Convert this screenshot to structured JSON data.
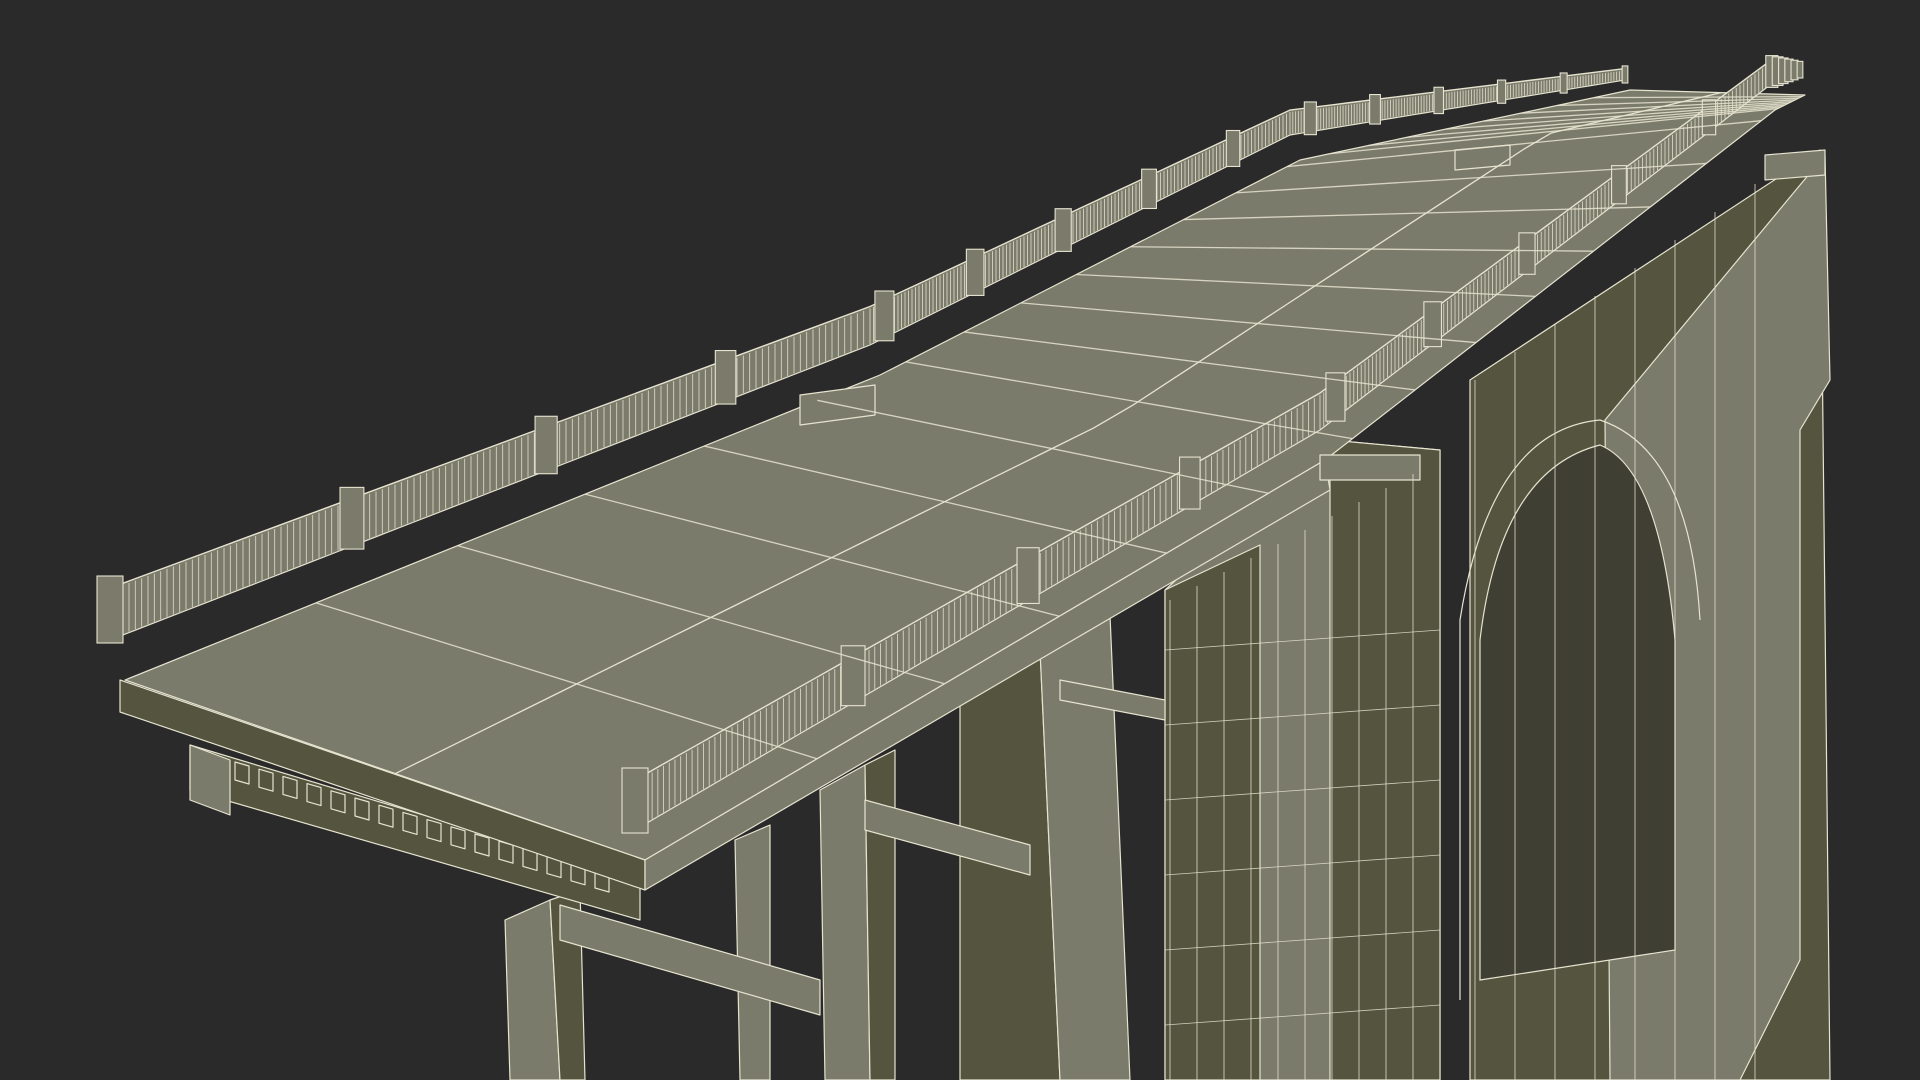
{
  "viewport": {
    "background_color": "#2a2a2a"
  },
  "model": {
    "subject": "arch-bridge-wireframe",
    "surface_color": "#7b7b6c",
    "surface_dark_color": "#54543f",
    "surface_shadow_color": "#3f3f34",
    "wire_color": "#e6e3cf"
  }
}
